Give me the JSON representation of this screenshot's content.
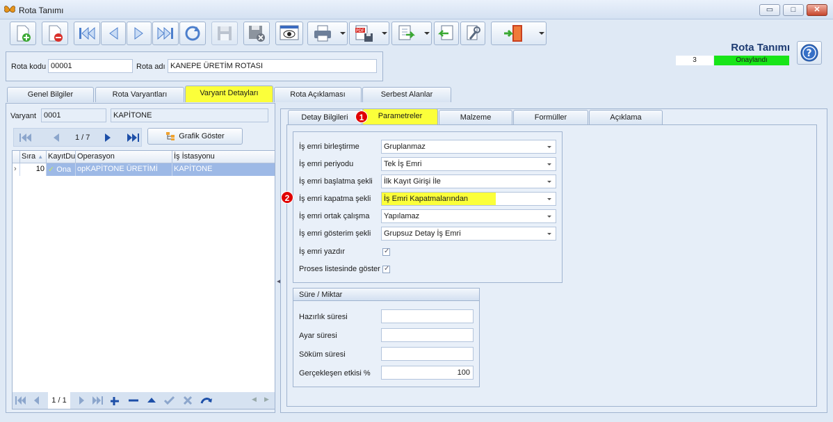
{
  "window": {
    "title": "Rota Tanımı",
    "minimize": "▭",
    "maximize": "□",
    "close": "✕"
  },
  "header": {
    "form_title": "Rota Tanımı",
    "status_number": "3",
    "status_text": "Onaylandı",
    "status_color": "#18e518"
  },
  "toolbar": {
    "icons": [
      "new-icon",
      "delete-icon",
      "first-icon",
      "previous-icon",
      "next-icon",
      "last-icon",
      "refresh-icon",
      "save-disabled-icon",
      "cancel-save-disabled-icon",
      "preview-icon",
      "print-icon",
      "pdf-export-icon",
      "export-icon",
      "import-icon",
      "tools-icon",
      "exit-icon",
      "help-icon"
    ]
  },
  "rota": {
    "kod_label": "Rota kodu",
    "kod_value": "00001",
    "adi_label": "Rota adı",
    "adi_value": "KANEPE ÜRETİM ROTASI"
  },
  "main_tabs": [
    {
      "label": "Genel Bilgiler"
    },
    {
      "label": "Rota Varyantları"
    },
    {
      "label": "Varyant Detayları"
    },
    {
      "label": "Rota Açıklaması"
    },
    {
      "label": "Serbest Alanlar"
    }
  ],
  "varyant": {
    "label": "Varyant",
    "code": "0001",
    "name": "KAPİTONE",
    "nav_position": "1 / 7",
    "graph_button": "Grafik Göster"
  },
  "grid": {
    "columns": [
      "Sıra",
      "KayıtDu",
      "Operasyon",
      "İş İstasyonu"
    ],
    "rows": [
      {
        "sira": "10",
        "durum": "Ona",
        "operasyon": "opKAPİTONE ÜRETİMİ",
        "istasyon": "KAPİTONE"
      }
    ],
    "footer_position": "1 / 1"
  },
  "sub_tabs": [
    {
      "label": "Detay Bilgileri"
    },
    {
      "label": "Parametreler"
    },
    {
      "label": "Malzeme"
    },
    {
      "label": "Formüller"
    },
    {
      "label": "Açıklama"
    }
  ],
  "markers": {
    "one": "1",
    "two": "2"
  },
  "params": [
    {
      "label": "İş emri birleştirme",
      "value": "Gruplanmaz"
    },
    {
      "label": "İş emri periyodu",
      "value": "Tek İş Emri"
    },
    {
      "label": "İş emri başlatma şekli",
      "value": "İlk Kayıt Girişi İle"
    },
    {
      "label": "İş emri kapatma şekli",
      "value": "İş Emri Kapatmalarından"
    },
    {
      "label": "İş emri ortak çalışma",
      "value": "Yapılamaz"
    },
    {
      "label": "İş emri gösterim şekli",
      "value": "Grupsuz Detay İş Emri"
    }
  ],
  "checks": [
    {
      "label": "İş emri yazdır",
      "mark": "✓"
    },
    {
      "label": "Proses listesinde göster",
      "mark": "✓"
    }
  ],
  "sure": {
    "title": "Süre / Miktar",
    "fields": [
      {
        "label": "Hazırlık süresi",
        "value": ""
      },
      {
        "label": "Ayar süresi",
        "value": ""
      },
      {
        "label": "Söküm süresi",
        "value": ""
      },
      {
        "label": "Gerçekleşen etkisi %",
        "value": "100"
      }
    ]
  }
}
